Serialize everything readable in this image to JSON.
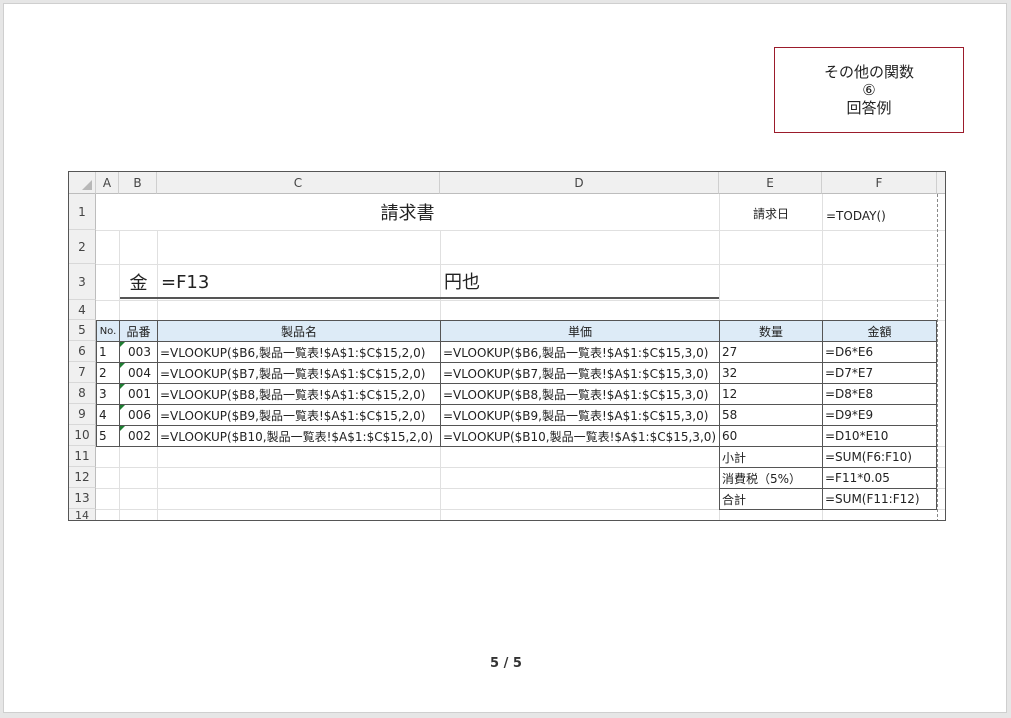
{
  "title_box": {
    "line1": "その他の関数",
    "line2": "⑥",
    "line3": "回答例"
  },
  "columns": [
    "A",
    "B",
    "C",
    "D",
    "E",
    "F"
  ],
  "row_numbers": [
    "1",
    "2",
    "3",
    "4",
    "5",
    "6",
    "7",
    "8",
    "9",
    "10",
    "11",
    "12",
    "13",
    "14"
  ],
  "invoice": {
    "title": "請求書",
    "date_label": "請求日",
    "date_formula": "=TODAY()",
    "kin": "金",
    "amount_formula": "=F13",
    "yen": "円也"
  },
  "table": {
    "headers": [
      "No.",
      "品番",
      "製品名",
      "単価",
      "数量",
      "金額"
    ],
    "rows": [
      {
        "no": "1",
        "code": "003",
        "name": "=VLOOKUP($B6,製品一覧表!$A$1:$C$15,2,0)",
        "price": "=VLOOKUP($B6,製品一覧表!$A$1:$C$15,3,0)",
        "qty": "27",
        "amount": "=D6*E6"
      },
      {
        "no": "2",
        "code": "004",
        "name": "=VLOOKUP($B7,製品一覧表!$A$1:$C$15,2,0)",
        "price": "=VLOOKUP($B7,製品一覧表!$A$1:$C$15,3,0)",
        "qty": "32",
        "amount": "=D7*E7"
      },
      {
        "no": "3",
        "code": "001",
        "name": "=VLOOKUP($B8,製品一覧表!$A$1:$C$15,2,0)",
        "price": "=VLOOKUP($B8,製品一覧表!$A$1:$C$15,3,0)",
        "qty": "12",
        "amount": "=D8*E8"
      },
      {
        "no": "4",
        "code": "006",
        "name": "=VLOOKUP($B9,製品一覧表!$A$1:$C$15,2,0)",
        "price": "=VLOOKUP($B9,製品一覧表!$A$1:$C$15,3,0)",
        "qty": "58",
        "amount": "=D9*E9"
      },
      {
        "no": "5",
        "code": "002",
        "name": "=VLOOKUP($B10,製品一覧表!$A$1:$C$15,2,0)",
        "price": "=VLOOKUP($B10,製品一覧表!$A$1:$C$15,3,0)",
        "qty": "60",
        "amount": "=D10*E10"
      }
    ],
    "summary": [
      {
        "label": "小計",
        "formula": "=SUM(F6:F10)"
      },
      {
        "label": "消費税（5%）",
        "formula": "=F11*0.05"
      },
      {
        "label": "合計",
        "formula": "=SUM(F11:F12)"
      }
    ]
  },
  "page_number": "5 / 5"
}
